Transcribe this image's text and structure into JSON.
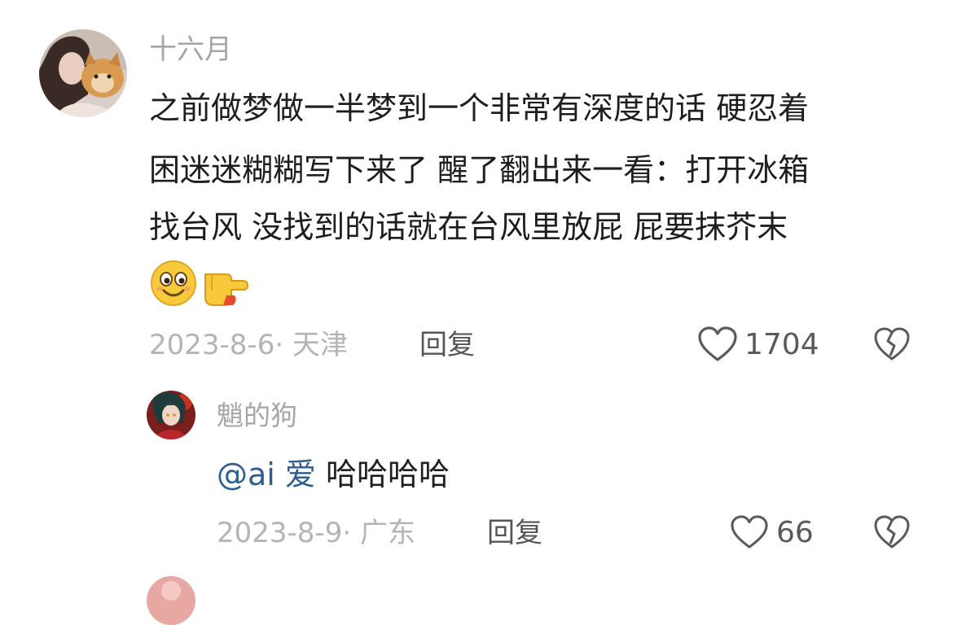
{
  "comment": {
    "username": "十六月",
    "text_lines": [
      "之前做梦做一半梦到一个非常有深度的话 硬忍着",
      "困迷迷糊糊写下来了 醒了翻出来一看：打开冰箱",
      "找台风 没找到的话就在台风里放屁 屁要抹芥末"
    ],
    "emojis": [
      "smiling-face-emoji",
      "backhand-index-pointing-right-emoji"
    ],
    "date": "2023-8-6",
    "location": "天津",
    "reply_label": "回复",
    "like_count": "1704",
    "icons": [
      "heart-outline-icon",
      "broken-heart-icon"
    ]
  },
  "reply": {
    "username": "魈的狗",
    "mention": "@ai 爱",
    "text": "哈哈哈哈",
    "date": "2023-8-9",
    "location": "广东",
    "reply_label": "回复",
    "like_count": "66",
    "icons": [
      "heart-outline-icon",
      "broken-heart-icon"
    ]
  },
  "colors": {
    "username": "#a6a6a6",
    "body_text": "#1e1e1e",
    "meta_text": "#b4b4b4",
    "mention": "#2c5e92",
    "icon_stroke": "#5a5a5a",
    "emoji_yellow": "#f8c93a"
  }
}
